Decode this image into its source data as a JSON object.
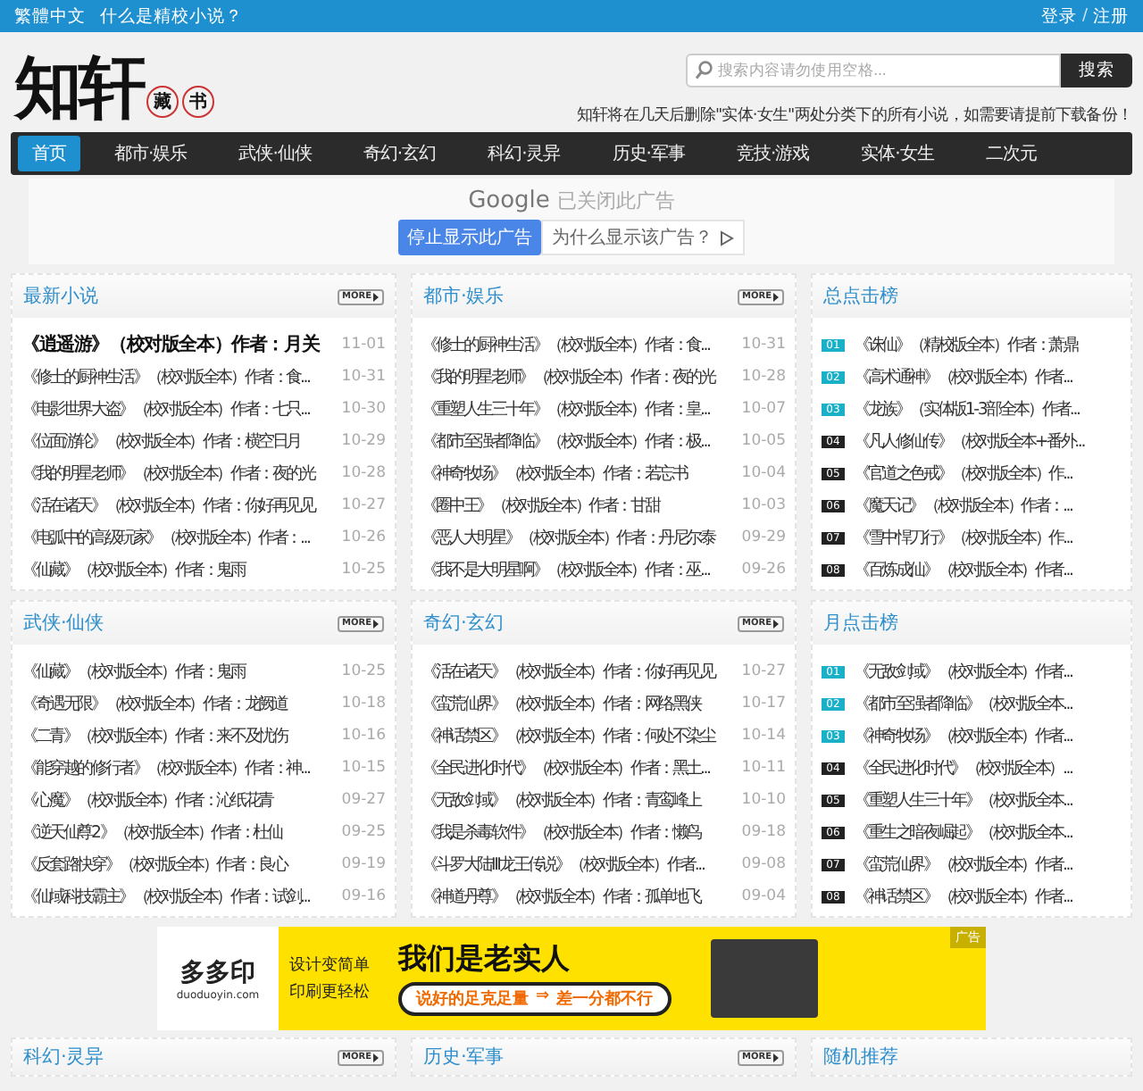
{
  "top_bar": {
    "links": [
      "繁體中文",
      "什么是精校小说？"
    ],
    "login": "登录",
    "separator": "/",
    "register": "注册"
  },
  "logo": {
    "main": "知轩",
    "seals": [
      "藏",
      "书"
    ]
  },
  "search": {
    "placeholder": "搜索内容请勿使用空格...",
    "button": "搜索"
  },
  "notice": "知轩将在几天后删除\"实体·女生\"两处分类下的所有小说，如需要请提前下载备份！",
  "nav": [
    {
      "label": "首页",
      "selected": true
    },
    {
      "label": "都市·娱乐",
      "selected": false
    },
    {
      "label": "武侠·仙侠",
      "selected": false
    },
    {
      "label": "奇幻·玄幻",
      "selected": false
    },
    {
      "label": "科幻·灵异",
      "selected": false
    },
    {
      "label": "历史·军事",
      "selected": false
    },
    {
      "label": "竞技·游戏",
      "selected": false
    },
    {
      "label": "实体·女生",
      "selected": false
    },
    {
      "label": "二次元",
      "selected": false
    }
  ],
  "google_ad": {
    "brand": "Google",
    "status": "已关闭此广告",
    "stop_button": "停止显示此广告",
    "why_button": "为什么显示该广告？"
  },
  "section_rows": [
    {
      "sections": [
        {
          "kind": "list",
          "title": "最新小说",
          "more": "MORE",
          "items": [
            {
              "text": "《逍遥游》（校对版全本）作者：月关",
              "date": "11-01",
              "emphasized": true
            },
            {
              "text": "《修士的厨神生活》（校对版全本）作者：食...",
              "date": "10-31",
              "emphasized": false
            },
            {
              "text": "《电影世界大盗》（校对版全本）作者：七只...",
              "date": "10-30",
              "emphasized": false
            },
            {
              "text": "《位面游轮》（校对版全本）作者：横空日月",
              "date": "10-29",
              "emphasized": false
            },
            {
              "text": "《我的明星老师》（校对版全本）作者：夜的光",
              "date": "10-28",
              "emphasized": false
            },
            {
              "text": "《活在诸天》（校对版全本）作者：你好再见见",
              "date": "10-27",
              "emphasized": false
            },
            {
              "text": "《电弧中的高级玩家》（校对版全本）作者：...",
              "date": "10-26",
              "emphasized": false
            },
            {
              "text": "《仙藏》（校对版全本）作者：鬼雨",
              "date": "10-25",
              "emphasized": false
            }
          ]
        },
        {
          "kind": "list",
          "title": "都市·娱乐",
          "more": "MORE",
          "items": [
            {
              "text": "《修士的厨神生活》（校对版全本）作者：食...",
              "date": "10-31",
              "emphasized": false
            },
            {
              "text": "《我的明星老师》（校对版全本）作者：夜的光",
              "date": "10-28",
              "emphasized": false
            },
            {
              "text": "《重塑人生三十年》（校对版全本）作者：皇...",
              "date": "10-07",
              "emphasized": false
            },
            {
              "text": "《都市至强者降临》（校对版全本）作者：极...",
              "date": "10-05",
              "emphasized": false
            },
            {
              "text": "《神奇牧场》（校对版全本）作者：若忘书",
              "date": "10-04",
              "emphasized": false
            },
            {
              "text": "《圈中王》（校对版全本）作者：甘甜",
              "date": "10-03",
              "emphasized": false
            },
            {
              "text": "《恶人大明星》（校对版全本）作者：丹尼尔泰",
              "date": "09-29",
              "emphasized": false
            },
            {
              "text": "《我不是大明星啊》（校对版全本）作者：巫...",
              "date": "09-26",
              "emphasized": false
            }
          ]
        },
        {
          "kind": "rank",
          "title": "总点击榜",
          "items": [
            {
              "badge": "01",
              "color": "#1ab0c8",
              "text": "《诛仙》（精校版全本）作者：萧鼎"
            },
            {
              "badge": "02",
              "color": "#1ab0c8",
              "text": "《高术通神》（校对版全本）作者..."
            },
            {
              "badge": "03",
              "color": "#1ab0c8",
              "text": "《龙族》（实体版1-3部全本）作者..."
            },
            {
              "badge": "04",
              "color": "#222222",
              "text": "《凡人修仙传》（校对版全本+番外..."
            },
            {
              "badge": "05",
              "color": "#222222",
              "text": "《官道之色戒》（校对版全本）作..."
            },
            {
              "badge": "06",
              "color": "#222222",
              "text": "《魔天记》（校对版全本）作者：..."
            },
            {
              "badge": "07",
              "color": "#222222",
              "text": "《雪中悍刀行》（校对版全本）作..."
            },
            {
              "badge": "08",
              "color": "#222222",
              "text": "《百炼成仙》（校对版全本）作者..."
            }
          ]
        }
      ]
    },
    {
      "sections": [
        {
          "kind": "list",
          "title": "武侠·仙侠",
          "more": "MORE",
          "items": [
            {
              "text": "《仙藏》（校对版全本）作者：鬼雨",
              "date": "10-25",
              "emphasized": false
            },
            {
              "text": "《奇遇无限》（校对版全本）作者：龙阙道",
              "date": "10-18",
              "emphasized": false
            },
            {
              "text": "《二青》（校对版全本）作者：来不及忧伤",
              "date": "10-16",
              "emphasized": false
            },
            {
              "text": "《能穿越的修行者》（校对版全本）作者：神...",
              "date": "10-15",
              "emphasized": false
            },
            {
              "text": "《心魔》（校对版全本）作者：沁纸花青",
              "date": "09-27",
              "emphasized": false
            },
            {
              "text": "《逆天仙尊2》（校对版全本）作者：杜仙",
              "date": "09-25",
              "emphasized": false
            },
            {
              "text": "《反套路快穿》（校对版全本）作者：良心",
              "date": "09-19",
              "emphasized": false
            },
            {
              "text": "《仙域科技霸主》（校对版全本）作者：试剑...",
              "date": "09-16",
              "emphasized": false
            }
          ]
        },
        {
          "kind": "list",
          "title": "奇幻·玄幻",
          "more": "MORE",
          "items": [
            {
              "text": "《活在诸天》（校对版全本）作者：你好再见见",
              "date": "10-27",
              "emphasized": false
            },
            {
              "text": "《蛮荒仙界》（校对版全本）作者：网络黑侠",
              "date": "10-17",
              "emphasized": false
            },
            {
              "text": "《神话禁区》（校对版全本）作者：何处不染尘",
              "date": "10-14",
              "emphasized": false
            },
            {
              "text": "《全民进化时代》（校对版全本）作者：黑土...",
              "date": "10-11",
              "emphasized": false
            },
            {
              "text": "《无敌剑域》（校对版全本）作者：青鸾峰上",
              "date": "10-10",
              "emphasized": false
            },
            {
              "text": "《我是杀毒软件》（校对版全本）作者：懒鸟",
              "date": "09-18",
              "emphasized": false
            },
            {
              "text": "《斗罗大陆III龙王传说》（校对版全本）作者...",
              "date": "09-08",
              "emphasized": false
            },
            {
              "text": "《神道丹尊》（校对版全本）作者：孤单地飞",
              "date": "09-04",
              "emphasized": false
            }
          ]
        },
        {
          "kind": "rank",
          "title": "月点击榜",
          "items": [
            {
              "badge": "01",
              "color": "#1ab0c8",
              "text": "《无敌剑域》（校对版全本）作者..."
            },
            {
              "badge": "02",
              "color": "#1ab0c8",
              "text": "《都市至强者降临》（校对版全本..."
            },
            {
              "badge": "03",
              "color": "#1ab0c8",
              "text": "《神奇牧场》（校对版全本）作者..."
            },
            {
              "badge": "04",
              "color": "#222222",
              "text": "《全民进化时代》（校对版全本）..."
            },
            {
              "badge": "05",
              "color": "#222222",
              "text": "《重塑人生三十年》（校对版全本..."
            },
            {
              "badge": "06",
              "color": "#222222",
              "text": "《重生之暗夜崛起》（校对版全本..."
            },
            {
              "badge": "07",
              "color": "#222222",
              "text": "《蛮荒仙界》（校对版全本）作者..."
            },
            {
              "badge": "08",
              "color": "#222222",
              "text": "《神话禁区》（校对版全本）作者..."
            }
          ]
        }
      ]
    }
  ],
  "banner_ad": {
    "brand": "多多印",
    "site": "duoduoyin.com",
    "slogan_lines": [
      "设计变简单",
      "印刷更轻松"
    ],
    "headline": "我们是老实人",
    "tagline": "说好的足克足量",
    "arrow": "⇒",
    "tagline_end": "差一分都不行",
    "ad_tag": "广告"
  },
  "bottom_sections": [
    {
      "title": "科幻·灵异",
      "more": "MORE"
    },
    {
      "title": "历史·军事",
      "more": "MORE"
    },
    {
      "title": "随机推荐"
    }
  ]
}
